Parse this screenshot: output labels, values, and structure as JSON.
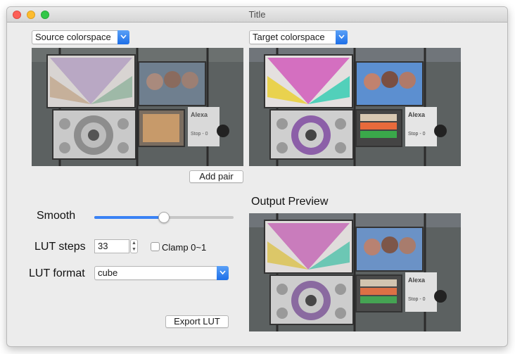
{
  "window": {
    "title": "Title"
  },
  "source": {
    "colorspace_label": "Source colorspace"
  },
  "target": {
    "colorspace_label": "Target colorspace"
  },
  "buttons": {
    "add_pair": "Add  pair",
    "export_lut": "Export LUT"
  },
  "output_preview": {
    "heading": "Output Preview"
  },
  "controls": {
    "smooth_label": "Smooth",
    "smooth_value": 0.5,
    "lut_steps_label": "LUT steps",
    "lut_steps_value": "33",
    "clamp_label": "Clamp 0~1",
    "clamp_checked": false,
    "lut_format_label": "LUT format",
    "lut_format_value": "cube"
  },
  "photo_text": {
    "sign_brand": "Alexa",
    "sign_stop": "Stop - 0"
  },
  "icons": {
    "popup_arrow": "chevron-down-icon"
  },
  "colors": {
    "accent": "#3a82f5",
    "close": "#fc5f57",
    "minimize": "#fdbc2e",
    "maximize": "#33c748"
  }
}
